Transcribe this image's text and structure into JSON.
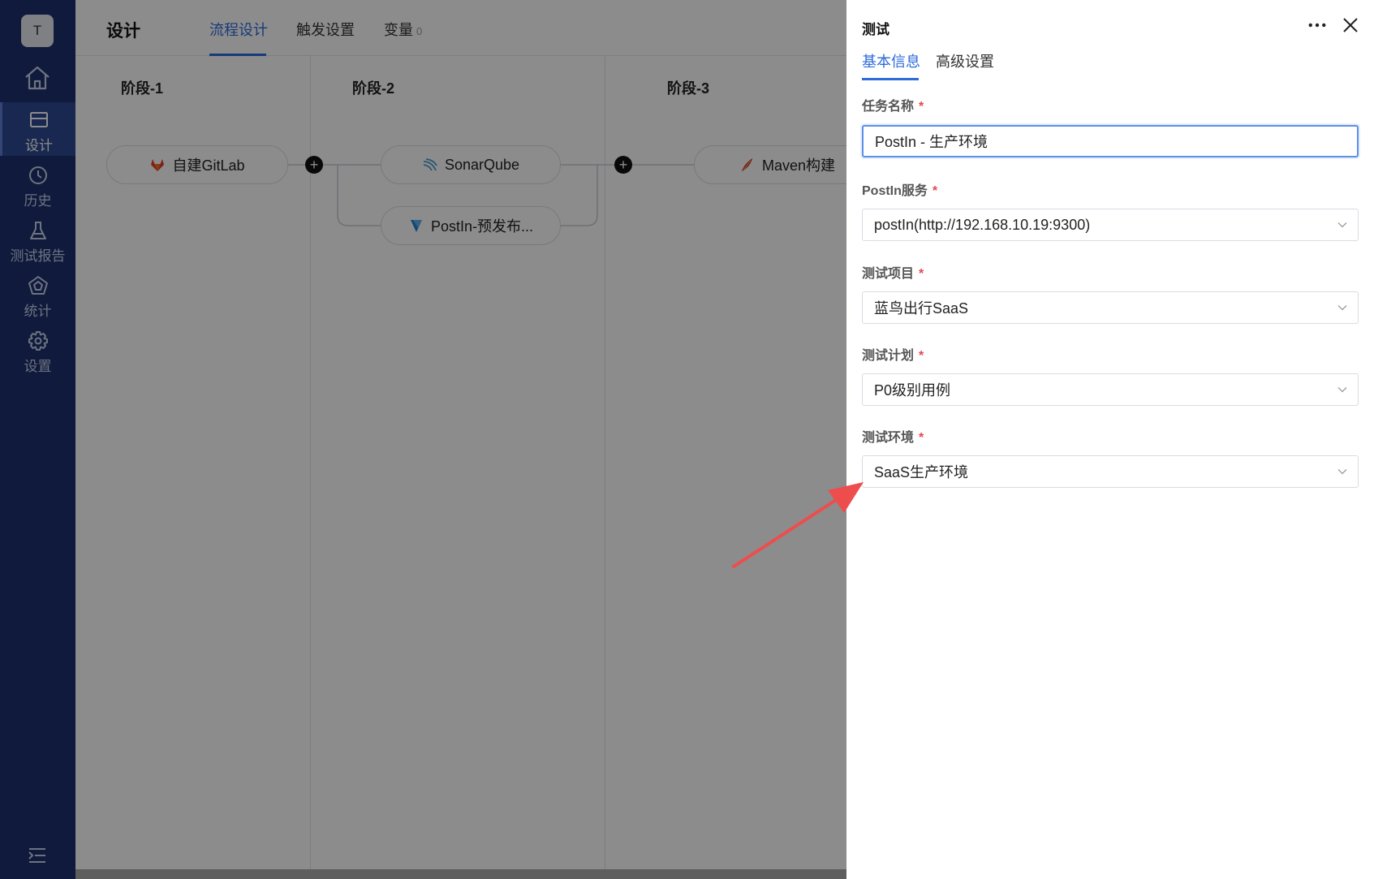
{
  "sidebar": {
    "avatar_letter": "T",
    "items": [
      {
        "label": "设计",
        "icon": "design-icon",
        "active": true
      },
      {
        "label": "历史",
        "icon": "clock-icon",
        "active": false
      },
      {
        "label": "测试报告",
        "icon": "flask-icon",
        "active": false
      },
      {
        "label": "统计",
        "icon": "pentagon-chart-icon",
        "active": false
      },
      {
        "label": "设置",
        "icon": "gear-icon",
        "active": false
      }
    ]
  },
  "header": {
    "title": "设计",
    "tabs": [
      {
        "label": "流程设计",
        "active": true
      },
      {
        "label": "触发设置",
        "active": false
      },
      {
        "label": "变量",
        "count": "0",
        "active": false
      }
    ]
  },
  "pipeline": {
    "stages": [
      {
        "title": "阶段-1",
        "tasks": [
          {
            "label": "自建GitLab",
            "icon": "gitlab-icon"
          }
        ]
      },
      {
        "title": "阶段-2",
        "tasks": [
          {
            "label": "SonarQube",
            "icon": "sonarqube-icon"
          },
          {
            "label": "PostIn-预发布...",
            "icon": "postin-icon"
          }
        ]
      },
      {
        "title": "阶段-3",
        "tasks": [
          {
            "label": "Maven构建",
            "icon": "maven-icon"
          }
        ]
      }
    ]
  },
  "drawer": {
    "title": "测试",
    "tabs": [
      {
        "label": "基本信息",
        "active": true
      },
      {
        "label": "高级设置",
        "active": false
      }
    ],
    "fields": [
      {
        "label": "任务名称",
        "required": true,
        "value": "PostIn - 生产环境",
        "type": "input"
      },
      {
        "label": "PostIn服务",
        "required": true,
        "value": "postIn(http://192.168.10.19:9300)",
        "type": "select"
      },
      {
        "label": "测试项目",
        "required": true,
        "value": "蓝鸟出行SaaS",
        "type": "select"
      },
      {
        "label": "测试计划",
        "required": true,
        "value": "P0级别用例",
        "type": "select"
      },
      {
        "label": "测试环境",
        "required": true,
        "value": "SaaS生产环境",
        "type": "select"
      }
    ],
    "required_mark": "*"
  },
  "colors": {
    "sidebar_bg": "#1c3170",
    "accent": "#2d6bda",
    "required": "#e5484d",
    "annotation_arrow": "#ee4d4d"
  }
}
